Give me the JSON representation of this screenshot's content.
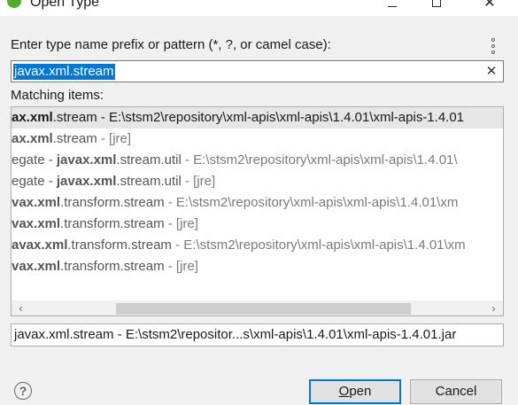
{
  "window": {
    "title": "Open Type",
    "controls": {
      "minimize": "–",
      "maximize": "□",
      "close": "✕"
    }
  },
  "prompt": {
    "label": "Enter type name prefix or pattern (*, ?, or camel case):"
  },
  "search": {
    "value": "javax.xml.stream",
    "clear_glyph": "✕"
  },
  "matching": {
    "label": "Matching items:"
  },
  "results": [
    {
      "pre": "",
      "bold": "ax.xml",
      "rest": ".stream",
      "suffix": " - E:\\stsm2\\repository\\xml-apis\\xml-apis\\1.4.01\\xml-apis-1.4.01",
      "selected": true
    },
    {
      "pre": "",
      "bold": "ax.xml",
      "rest": ".stream",
      "suffix": " - [jre]",
      "selected": false
    },
    {
      "pre": "egate",
      "bold": "javax.xml",
      "rest": ".stream.util",
      "suffix": " - E:\\stsm2\\repository\\xml-apis\\xml-apis\\1.4.01\\",
      "selected": false
    },
    {
      "pre": "egate",
      "bold": "javax.xml",
      "rest": ".stream.util",
      "suffix": " - [jre]",
      "selected": false
    },
    {
      "pre": "",
      "bold": "vax.xml",
      "rest": ".transform.stream",
      "suffix": " - E:\\stsm2\\repository\\xml-apis\\xml-apis\\1.4.01\\xm",
      "selected": false
    },
    {
      "pre": "",
      "bold": "vax.xml",
      "rest": ".transform.stream",
      "suffix": " - [jre]",
      "selected": false
    },
    {
      "pre": "",
      "bold": "avax.xml",
      "rest": ".transform.stream",
      "suffix": " - E:\\stsm2\\repository\\xml-apis\\xml-apis\\1.4.01\\xm",
      "selected": false
    },
    {
      "pre": "",
      "bold": "vax.xml",
      "rest": ".transform.stream",
      "suffix": " - [jre]",
      "selected": false
    }
  ],
  "scrollbar": {
    "left_arrow": "‹",
    "right_arrow": "›"
  },
  "detail": {
    "text": "javax.xml.stream - E:\\stsm2\\repositor...s\\xml-apis\\1.4.01\\xml-apis-1.4.01.jar"
  },
  "buttons": {
    "help_glyph": "?",
    "open": {
      "mnemonic": "O",
      "rest": "pen"
    },
    "cancel": {
      "label": "Cancel"
    }
  }
}
